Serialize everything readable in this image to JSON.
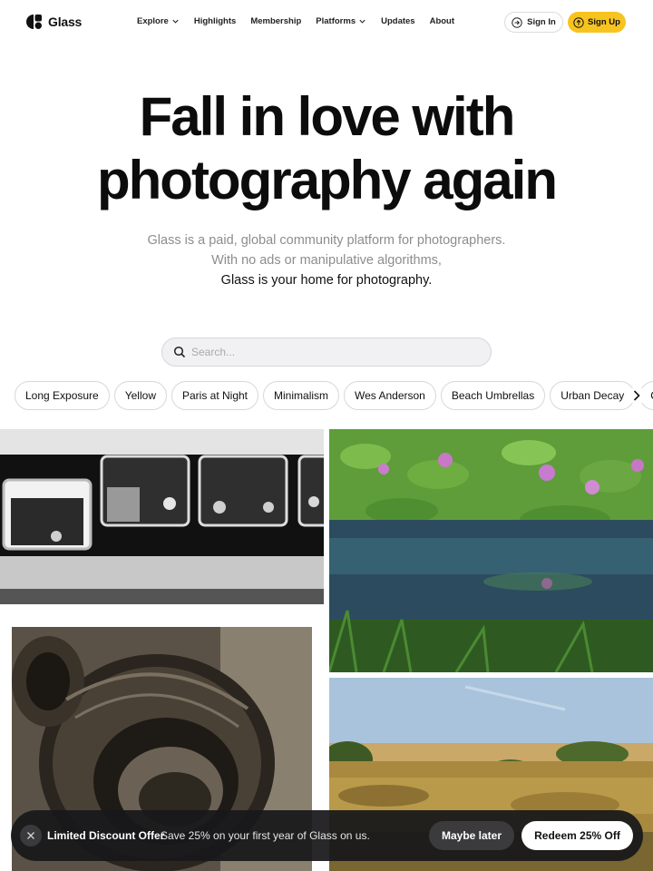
{
  "brand": {
    "name": "Glass",
    "accent": "#f7c31f"
  },
  "nav": {
    "items": [
      {
        "label": "Explore",
        "has_dropdown": true
      },
      {
        "label": "Highlights",
        "has_dropdown": false
      },
      {
        "label": "Membership",
        "has_dropdown": false
      },
      {
        "label": "Platforms",
        "has_dropdown": true
      },
      {
        "label": "Updates",
        "has_dropdown": false
      },
      {
        "label": "About",
        "has_dropdown": false
      }
    ],
    "signin_label": "Sign In",
    "signup_label": "Sign Up"
  },
  "hero": {
    "title_line1": "Fall in love with",
    "title_line2": "photography again",
    "sub_line1": "Glass is a paid, global community platform for photographers.",
    "sub_line2": "With no ads or manipulative algorithms,",
    "sub_line3": "Glass is your home for photography."
  },
  "search": {
    "placeholder": "Search..."
  },
  "tags": [
    "Long Exposure",
    "Yellow",
    "Paris at Night",
    "Minimalism",
    "Wes Anderson",
    "Beach Umbrellas",
    "Urban Decay",
    "Cinematic"
  ],
  "photos": [
    {
      "subject": "black-and-white train windows with passengers"
    },
    {
      "subject": "purple water hyacinth flowers over reflective water"
    },
    {
      "subject": "sepia stack of old tires"
    },
    {
      "subject": "golden meadow landscape under blue sky"
    }
  ],
  "banner": {
    "title": "Limited Discount Offer",
    "text": "Save 25% on your first year of Glass on us.",
    "maybe_label": "Maybe later",
    "redeem_label": "Redeem 25% Off"
  }
}
